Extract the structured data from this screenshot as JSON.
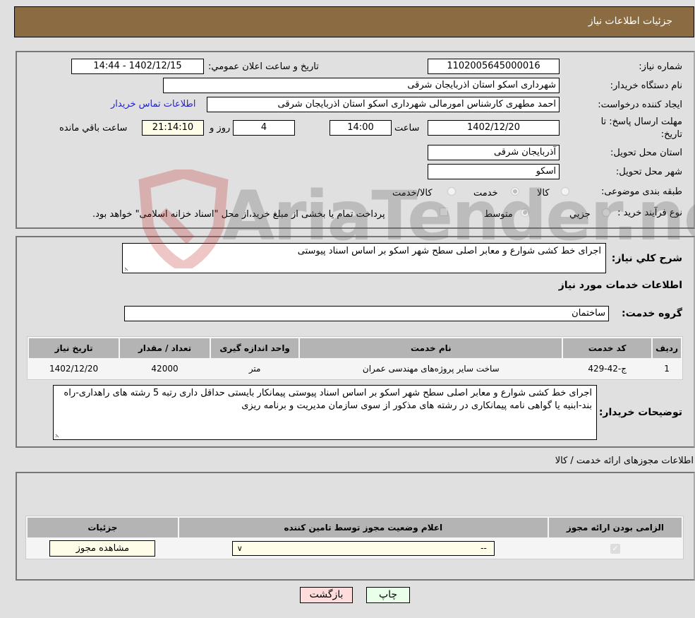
{
  "header": {
    "title": "جزئیات اطلاعات نیاز"
  },
  "form": {
    "need_number_label": "شماره نیاز:",
    "need_number": "1102005645000016",
    "announce_label": "تاریخ و ساعت اعلان عمومي:",
    "announce_value": "1402/12/15 - 14:44",
    "buyer_org_label": "نام دستگاه خریدار:",
    "buyer_org": "شهرداری اسکو استان اذربایجان شرقی",
    "creator_label": "ایجاد کننده درخواست:",
    "creator": "احمد مطهری کارشناس امورمالی شهرداری اسکو استان اذربایجان شرقی",
    "contact_link": "اطلاعات تماس خریدار",
    "deadline_label_1": "مهلت ارسال پاسخ: تا",
    "deadline_label_2": "تاریخ:",
    "deadline_date": "1402/12/20",
    "time_label": "ساعت",
    "deadline_time": "14:00",
    "days_value": "4",
    "days_label": "روز و",
    "remaining_time": "21:14:10",
    "remaining_label": "ساعت باقي مانده",
    "province_label": "استان محل تحویل:",
    "province": "آذربایجان شرقی",
    "city_label": "شهر محل تحویل:",
    "city": "اسکو",
    "category_label": "طبقه بندی موضوعی:",
    "category_options": [
      {
        "label": "کالا",
        "selected": false
      },
      {
        "label": "خدمت",
        "selected": true
      },
      {
        "label": "کالا/خدمت",
        "selected": false
      }
    ],
    "process_label": "نوع فرآیند خرید :",
    "process_options": [
      {
        "label": "جزيي",
        "selected": false
      },
      {
        "label": "متوسط",
        "selected": true
      }
    ],
    "treasury_text": "پرداخت تمام یا بخشی از مبلغ خرید،از محل \"اسناد خزانه اسلامی\" خواهد بود."
  },
  "description": {
    "summary_label": "شرح کلي نياز:",
    "summary": "اجرای خط کشی شوارع و معابر اصلی سطح شهر اسکو  بر اساس اسناد پیوستی",
    "services_title": "اطلاعات خدمات مورد نیاز",
    "service_group_label": "گروه خدمت:",
    "service_group": "ساختمان"
  },
  "services_table": {
    "headers": [
      "ردیف",
      "کد خدمت",
      "نام خدمت",
      "واحد اندازه گیری",
      "تعداد / مقدار",
      "تاریخ نیاز"
    ],
    "rows": [
      [
        "1",
        "ج-42-429",
        "ساخت سایر پروژه‌های مهندسی عمران",
        "متر",
        "42000",
        "1402/12/20"
      ]
    ]
  },
  "buyer_notes": {
    "label": "توضیحات خریدار:",
    "text": "اجرای خط کشی شوارع و معابر اصلی سطح شهر اسکو بر اساس اسناد پیوستی  پیمانکار بایستی حداقل داری رتبه 5 رشته های راهداری-راه بند-ابنیه یا گواهی نامه پیمانکاری در رشته های مذکور از سوی سازمان مدیریت و برنامه ریزی"
  },
  "permits": {
    "title": "اطلاعات مجوزهای ارائه خدمت / کالا",
    "headers": [
      "الزامی بودن ارائه مجوز",
      "اعلام وضعیت مجوز توسط تامین کننده",
      "جزئیات"
    ],
    "row": {
      "required_checked": true,
      "status_value": "--",
      "details_button": "مشاهده مجوز"
    }
  },
  "buttons": {
    "print": "چاپ",
    "back": "بازگشت"
  },
  "watermark": {
    "text": "AriaTender.neT"
  }
}
